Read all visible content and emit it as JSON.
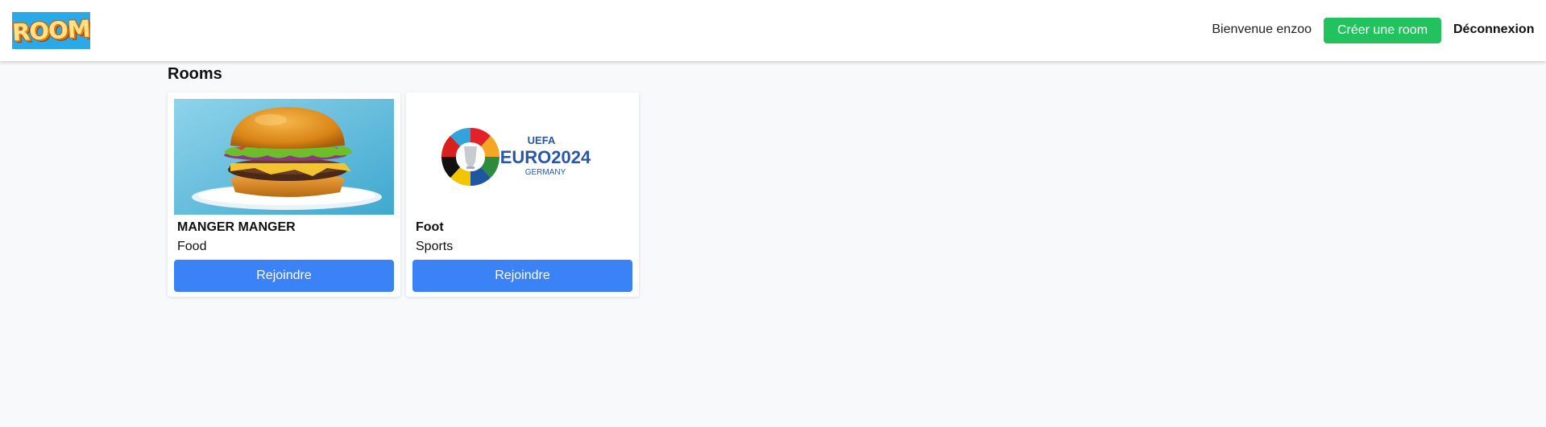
{
  "header": {
    "logo_text": "ROOM",
    "welcome": "Bienvenue enzoo",
    "create_label": "Créer une room",
    "logout_label": "Déconnexion"
  },
  "main": {
    "title": "Rooms",
    "rooms": [
      {
        "name": "MANGER MANGER",
        "category": "Food",
        "image": "burger-photo",
        "join_label": "Rejoindre"
      },
      {
        "name": "Foot",
        "category": "Sports",
        "image": "euro2024-logo",
        "image_text": {
          "top": "UEFA",
          "main": "EURO2024",
          "sub": "GERMANY"
        },
        "join_label": "Rejoindre"
      }
    ]
  },
  "colors": {
    "create_button": "#22c35e",
    "join_button": "#3b82f6",
    "logo_bg": "#29a9e8",
    "page_bg": "#f8f9fb"
  }
}
